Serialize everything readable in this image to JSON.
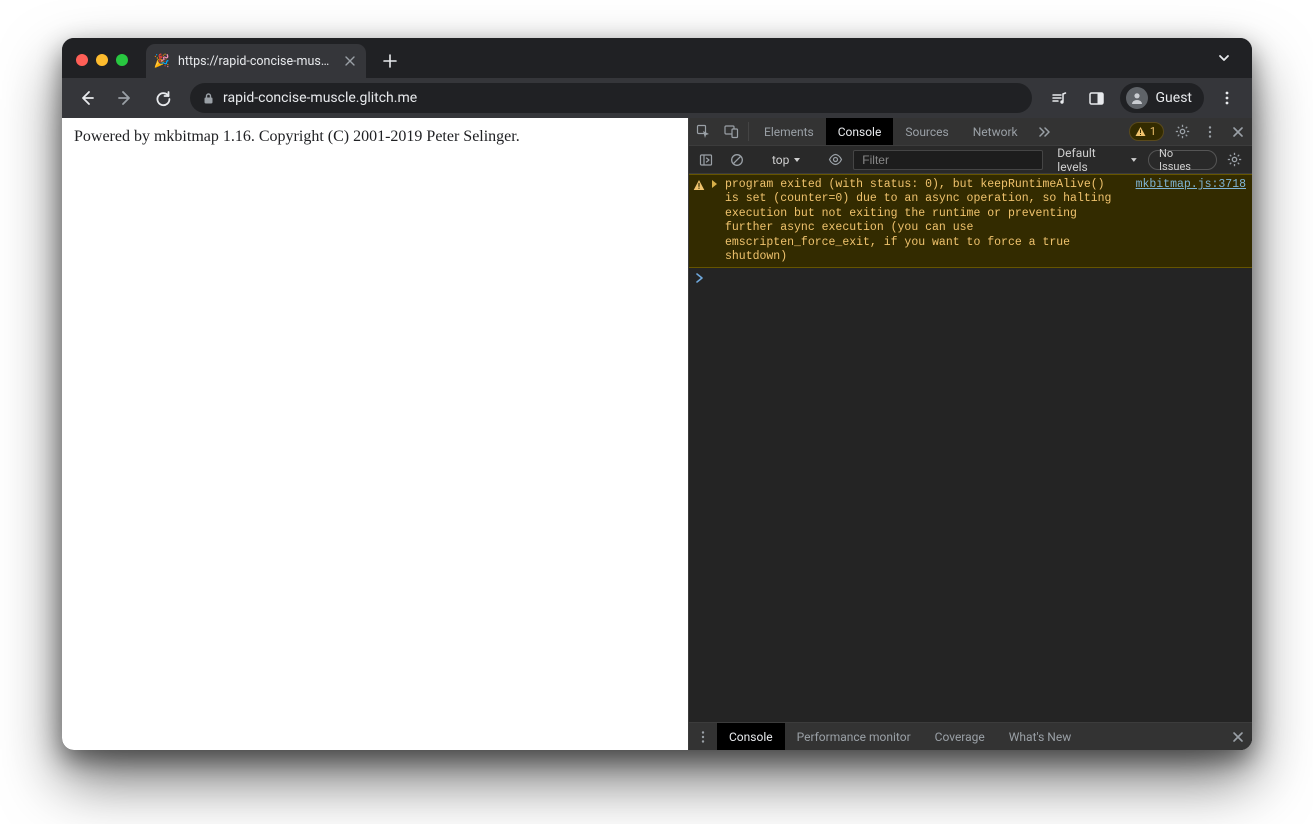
{
  "tab": {
    "title": "https://rapid-concise-muscle.g",
    "favicon": "🎉"
  },
  "toolbar": {
    "url_display": "rapid-concise-muscle.glitch.me",
    "profile_label": "Guest"
  },
  "page": {
    "body_text": "Powered by mkbitmap 1.16. Copyright (C) 2001-2019 Peter Selinger."
  },
  "devtools": {
    "tabs": {
      "elements": "Elements",
      "console": "Console",
      "sources": "Sources",
      "network": "Network"
    },
    "warning_count": "1",
    "console_tb": {
      "context": "top",
      "filter_placeholder": "Filter",
      "levels_label": "Default levels",
      "issues_label": "No Issues"
    },
    "console_log": {
      "warn_message": "program exited (with status: 0), but keepRuntimeAlive() is set (counter=0) due to an async operation, so halting execution but not exiting the runtime or preventing further async execution (you can use emscripten_force_exit, if you want to force a true shutdown)",
      "warn_source": "mkbitmap.js:3718"
    },
    "drawer": {
      "console": "Console",
      "perfmon": "Performance monitor",
      "coverage": "Coverage",
      "whatsnew": "What's New"
    }
  }
}
